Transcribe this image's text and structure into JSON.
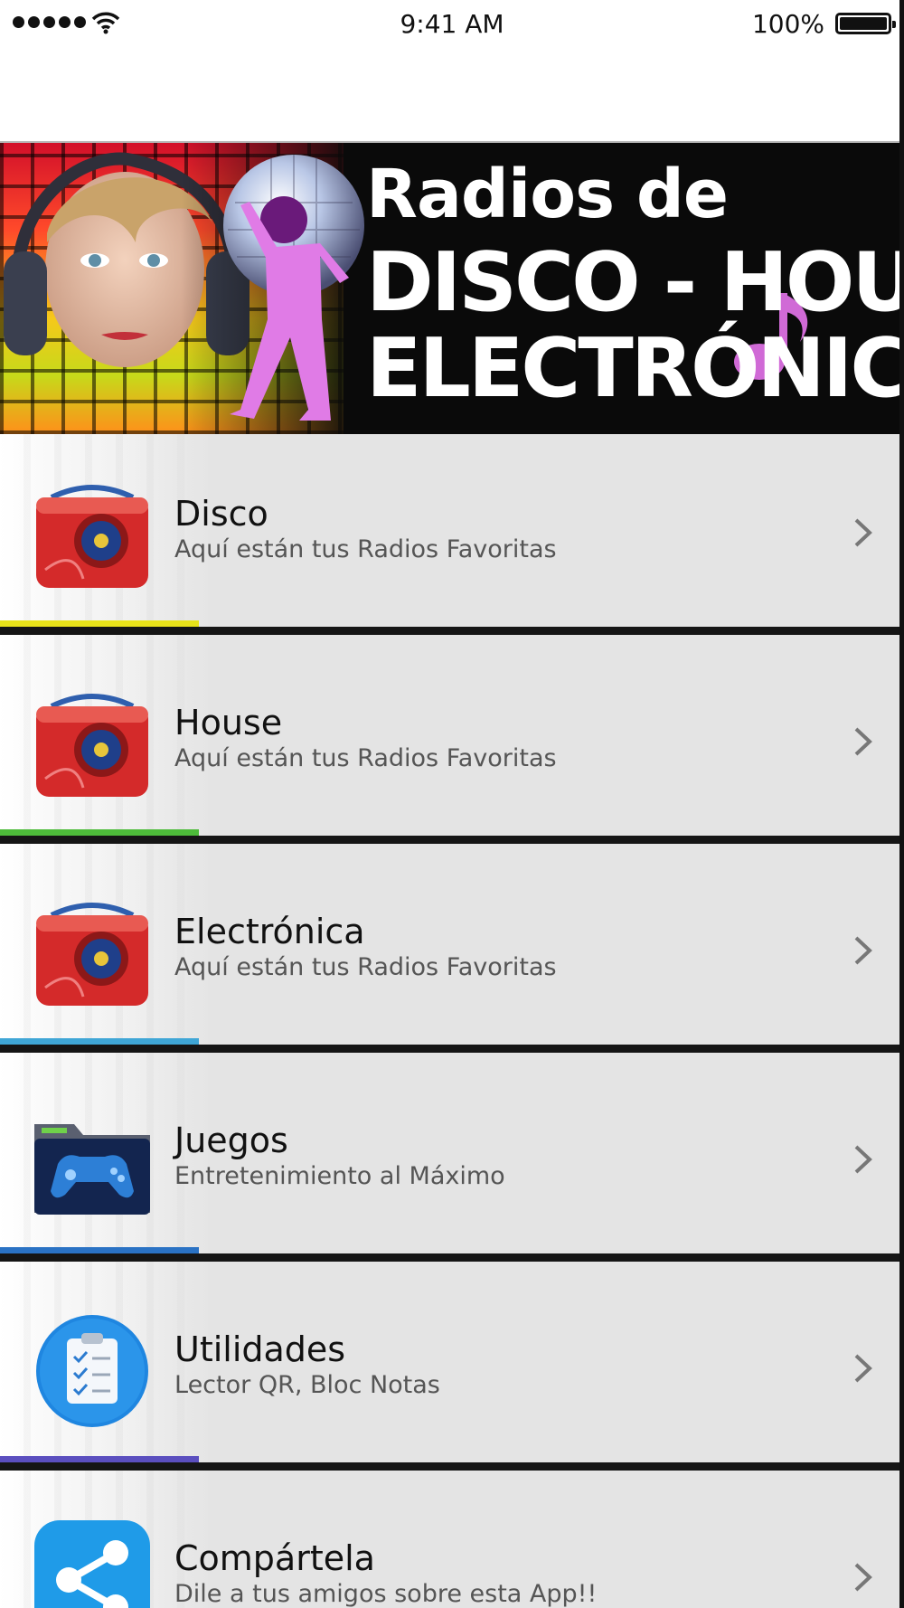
{
  "status_bar": {
    "time": "9:41 AM",
    "battery": "100%"
  },
  "banner": {
    "line1": "Radios de",
    "line2": "DISCO - HOUSE",
    "line3": "ELECTRÓNICA"
  },
  "menu": {
    "items": [
      {
        "title": "Disco",
        "subtitle": "Aquí están tus Radios Favoritas",
        "icon": "radio-icon",
        "strip_color": "#e8e21a"
      },
      {
        "title": "House",
        "subtitle": "Aquí están tus Radios Favoritas",
        "icon": "radio-icon",
        "strip_color": "#4dbb3a"
      },
      {
        "title": "Electrónica",
        "subtitle": "Aquí están tus Radios Favoritas",
        "icon": "radio-icon",
        "strip_color": "#3fa6d6"
      },
      {
        "title": "Juegos",
        "subtitle": "Entretenimiento al Máximo",
        "icon": "gamepad-folder-icon",
        "strip_color": "#2a72c4"
      },
      {
        "title": "Utilidades",
        "subtitle": "Lector QR, Bloc Notas",
        "icon": "clipboard-icon",
        "strip_color": "#5b4fbf"
      },
      {
        "title": "Compártela",
        "subtitle": "Dile a tus amigos sobre esta App!!",
        "icon": "share-icon",
        "strip_color": "#9a4fbf"
      }
    ]
  },
  "colors": {
    "radio_red": "#d42a2a",
    "accent_pink": "#e05cd8",
    "ios_blue": "#1f86e0"
  }
}
